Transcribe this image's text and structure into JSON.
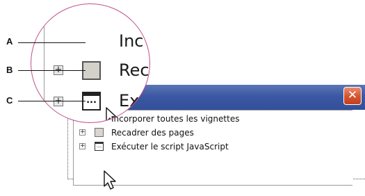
{
  "callouts": [
    {
      "letter": "A"
    },
    {
      "letter": "B"
    },
    {
      "letter": "C"
    }
  ],
  "magnifier": {
    "line1": "Inc",
    "line2": "Rec",
    "line3": "Ex",
    "expander_glyph": "+",
    "js_icon_glyph": "..."
  },
  "dialog": {
    "close_glyph": "✕"
  },
  "list": {
    "items": [
      {
        "label": "Incorporer toutes les vignettes",
        "icon": "none"
      },
      {
        "label": "Recadrer des pages",
        "icon": "page-square-icon"
      },
      {
        "label": "Exécuter le script JavaScript",
        "icon": "javascript-icon"
      }
    ],
    "expander_glyph": "+",
    "js_icon_glyph": "..."
  },
  "colors": {
    "titlebar": "#3c58a2",
    "close_button": "#d4532d",
    "magnifier_border": "#c0508a"
  }
}
